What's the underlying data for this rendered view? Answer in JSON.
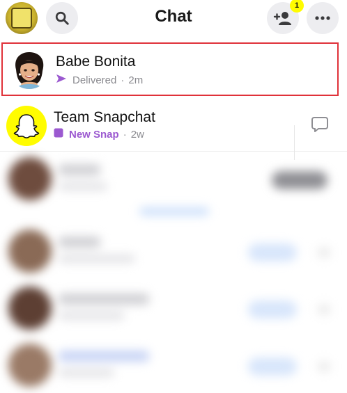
{
  "header": {
    "title": "Chat",
    "friend_request_count": "1",
    "icons": {
      "profile": "bitmoji-avatar-icon",
      "search": "search-icon",
      "add_friend": "add-friend-icon",
      "more": "more-dots-icon"
    }
  },
  "chats": [
    {
      "name": "Babe Bonita",
      "status": "Delivered",
      "time": "2m",
      "status_icon": "sent-arrow-icon",
      "status_color": "#9b59d0",
      "highlighted": true
    },
    {
      "name": "Team Snapchat",
      "status": "New Snap",
      "time": "2w",
      "status_icon": "new-snap-square-icon",
      "status_color": "#9b59d0",
      "action_icon": "chat-bubble-icon"
    }
  ],
  "colors": {
    "highlight_border": "#e0323a",
    "snap_yellow": "#fffc00",
    "snap_purple": "#9b59d0",
    "icon_button_bg": "#ededf0"
  }
}
